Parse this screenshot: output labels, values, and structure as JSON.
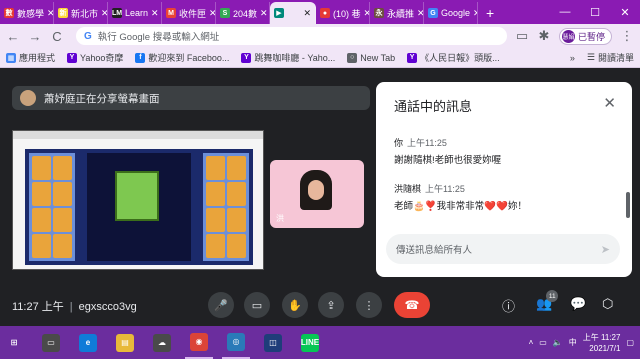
{
  "tabs": [
    {
      "label": "數感學",
      "color": "#e53935",
      "glyph": "數"
    },
    {
      "label": "新北市",
      "color": "#fdd835",
      "glyph": "新"
    },
    {
      "label": "Learn",
      "color": "#212121",
      "glyph": "LM"
    },
    {
      "label": "收件匣",
      "color": "#ea4335",
      "glyph": "M"
    },
    {
      "label": "204數",
      "color": "#34a853",
      "glyph": "S"
    },
    {
      "label": "",
      "color": "#00897b",
      "glyph": "▶",
      "active": true
    },
    {
      "label": "(10) 巷",
      "color": "#e53935",
      "glyph": "●"
    },
    {
      "label": "永續推",
      "color": "#6d4c41",
      "glyph": "永"
    },
    {
      "label": "Google",
      "color": "#4285f4",
      "glyph": "G"
    }
  ],
  "window_controls": {
    "minimize": "—",
    "maximize": "☐",
    "close": "✕"
  },
  "toolbar": {
    "back": "←",
    "forward": "→",
    "reload": "C",
    "address_placeholder": "執行 Google 搜尋或輸入網址",
    "profile_avatar": "慧娟",
    "profile_label": "已暫停"
  },
  "bookmarks": [
    {
      "label": "應用程式",
      "color": "#4285f4",
      "glyph": "▦"
    },
    {
      "label": "Yahoo奇摩",
      "color": "#6001d2",
      "glyph": "Y"
    },
    {
      "label": "歡迎來到 Faceboo...",
      "color": "#1877f2",
      "glyph": "f"
    },
    {
      "label": "跳舞咖啡廳 - Yaho...",
      "color": "#6001d2",
      "glyph": "Y"
    },
    {
      "label": "New Tab",
      "color": "#5f6368",
      "glyph": "○"
    },
    {
      "label": "《人民日報》頭版...",
      "color": "#6001d2",
      "glyph": "Y"
    }
  ],
  "bookmarks_more": "»",
  "reading_list": "閱讀清單",
  "presenter_banner": "蕭妤庭正在分享螢幕畫面",
  "participant_tile_name": "洪",
  "chat": {
    "title": "通話中的訊息",
    "close": "✕",
    "messages": [
      {
        "sender": "你",
        "time": "上午11:25",
        "text": "謝謝隨棋!老師也很愛妳喔"
      },
      {
        "sender": "洪隨棋",
        "time": "上午11:25",
        "text": "老師🎂❣️我非常非常❤️❤️妳！"
      }
    ],
    "input_placeholder": "傳送訊息給所有人",
    "send": "➤"
  },
  "meeting": {
    "time": "11:27 上午",
    "separator": "|",
    "code": "egxscco3vg"
  },
  "controls": {
    "mic": "🎤",
    "camera": "▭",
    "hand": "✋",
    "present": "⇪",
    "more": "⋮",
    "end": "☎"
  },
  "right_controls": {
    "info": "ⓘ",
    "people": "👥",
    "people_count": "11",
    "chat": "💬",
    "activities": "⬡"
  },
  "taskbar": {
    "clock_time": "上午 11:27",
    "clock_date": "2021/7/1",
    "ime": "中",
    "apps": [
      {
        "glyph": "⊞",
        "color": "#6b2d9e"
      },
      {
        "glyph": "▭",
        "color": "#4a4a4a"
      },
      {
        "glyph": "e",
        "color": "#0f7bd8"
      },
      {
        "glyph": "▤",
        "color": "#e8b93a"
      },
      {
        "glyph": "☁",
        "color": "#4a4a4a"
      },
      {
        "glyph": "◉",
        "color": "#db4437"
      },
      {
        "glyph": "◎",
        "color": "#2a7ab8"
      },
      {
        "glyph": "◫",
        "color": "#1f3d7a"
      },
      {
        "glyph": "LINE",
        "color": "#06c755"
      }
    ]
  }
}
